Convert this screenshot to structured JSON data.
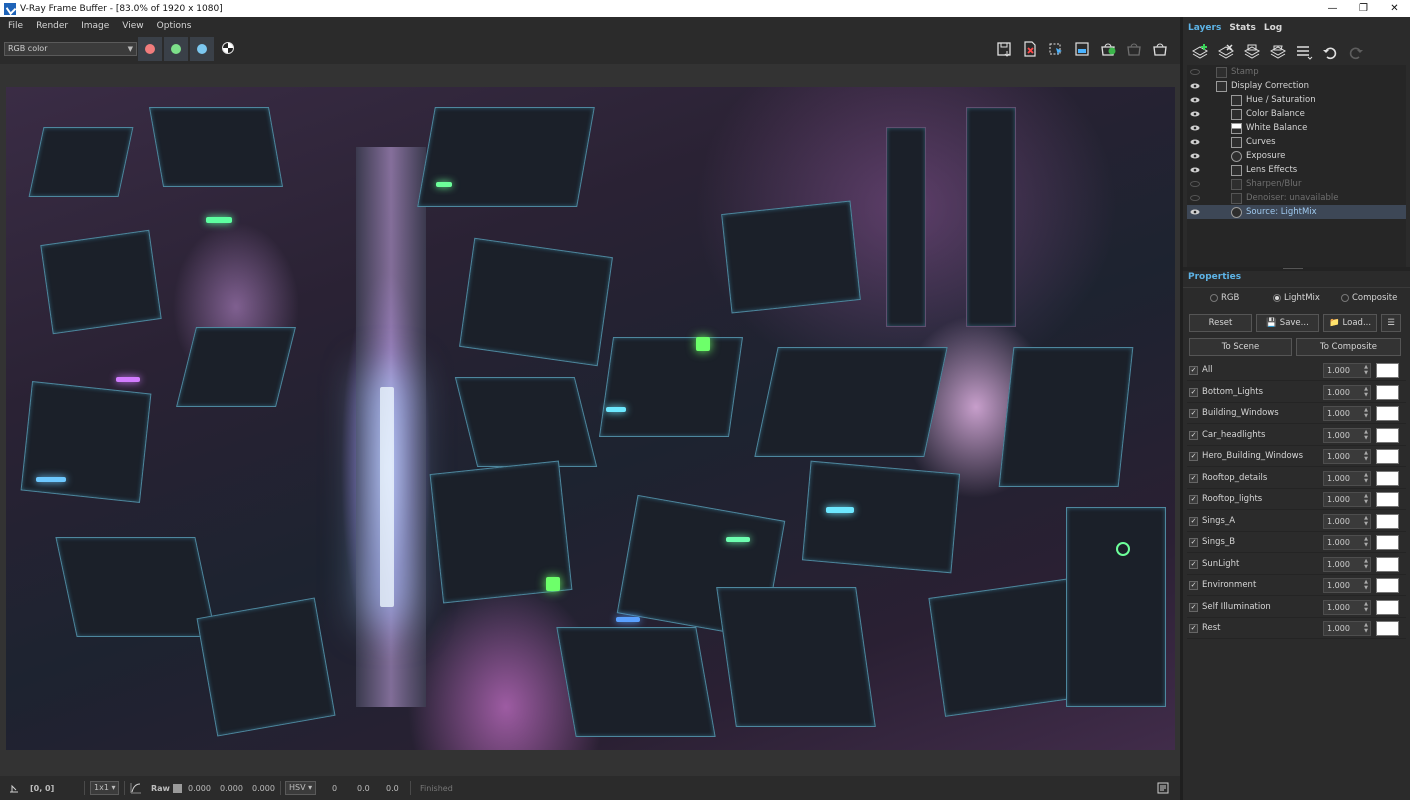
{
  "window": {
    "title": "V-Ray Frame Buffer - [83.0% of 1920 x 1080]",
    "controls": [
      "minimize",
      "maximize",
      "close"
    ]
  },
  "menu": [
    "File",
    "Render",
    "Image",
    "View",
    "Options"
  ],
  "toolbar": {
    "channel_select": "RGB color",
    "channel_buttons": [
      {
        "name": "red-channel",
        "color": "#f07c7c"
      },
      {
        "name": "green-channel",
        "color": "#7de08a"
      },
      {
        "name": "blue-channel",
        "color": "#7cc8f0"
      }
    ],
    "right_icons": [
      "save-image-icon",
      "clear-image-icon",
      "region-render-icon",
      "render-elements-icon",
      "render-icon",
      "render-interactive-icon",
      "stop-render-icon"
    ]
  },
  "status": {
    "coords": "[0, 0]",
    "zoom": "1x1",
    "raw_label": "Raw",
    "raw_values": [
      "0.000",
      "0.000",
      "0.000"
    ],
    "color_mode": "HSV",
    "hsv_values": [
      "0",
      "0.0",
      "0.0"
    ],
    "state": "Finished"
  },
  "panel": {
    "tabs": [
      "Layers",
      "Stats",
      "Log"
    ],
    "active_tab": "Layers",
    "layer_tool_icons": [
      "add-layer-icon",
      "remove-layer-icon",
      "save-layers-icon",
      "load-layers-icon",
      "layers-menu-icon",
      "undo-icon",
      "redo-icon"
    ],
    "layers": [
      {
        "name": "Stamp",
        "visible": false,
        "indent": 1,
        "enabled": false
      },
      {
        "name": "Display Correction",
        "visible": true,
        "indent": 1,
        "enabled": true
      },
      {
        "name": "Hue / Saturation",
        "visible": true,
        "indent": 2,
        "enabled": true
      },
      {
        "name": "Color Balance",
        "visible": true,
        "indent": 2,
        "enabled": true
      },
      {
        "name": "White Balance",
        "visible": true,
        "indent": 2,
        "enabled": true
      },
      {
        "name": "Curves",
        "visible": true,
        "indent": 2,
        "enabled": true
      },
      {
        "name": "Exposure",
        "visible": true,
        "indent": 2,
        "enabled": true
      },
      {
        "name": "Lens Effects",
        "visible": true,
        "indent": 2,
        "enabled": true
      },
      {
        "name": "Sharpen/Blur",
        "visible": false,
        "indent": 2,
        "enabled": false
      },
      {
        "name": "Denoiser: unavailable",
        "visible": false,
        "indent": 2,
        "enabled": false
      },
      {
        "name": "Source: LightMix",
        "visible": true,
        "indent": 2,
        "enabled": true,
        "selected": true
      }
    ],
    "properties_title": "Properties",
    "source_modes": [
      {
        "label": "RGB",
        "selected": false
      },
      {
        "label": "LightMix",
        "selected": true
      },
      {
        "label": "Composite",
        "selected": false
      }
    ],
    "buttons": {
      "reset": "Reset",
      "save": "Save...",
      "load": "Load...",
      "to_scene": "To Scene",
      "to_composite": "To Composite"
    },
    "lightmix": [
      {
        "name": "All",
        "value": "1.000",
        "checked": true
      },
      {
        "name": "Bottom_Lights",
        "value": "1.000",
        "checked": true
      },
      {
        "name": "Building_Windows",
        "value": "1.000",
        "checked": true
      },
      {
        "name": "Car_headlights",
        "value": "1.000",
        "checked": true
      },
      {
        "name": "Hero_Building_Windows",
        "value": "1.000",
        "checked": true
      },
      {
        "name": "Rooftop_details",
        "value": "1.000",
        "checked": true
      },
      {
        "name": "Rooftop_lights",
        "value": "1.000",
        "checked": true
      },
      {
        "name": "Sings_A",
        "value": "1.000",
        "checked": true
      },
      {
        "name": "Sings_B",
        "value": "1.000",
        "checked": true
      },
      {
        "name": "SunLight",
        "value": "1.000",
        "checked": true
      },
      {
        "name": "Environment",
        "value": "1.000",
        "checked": true
      },
      {
        "name": "Self Illumination",
        "value": "1.000",
        "checked": true
      },
      {
        "name": "Rest",
        "value": "1.000",
        "checked": true
      }
    ]
  },
  "colors": {
    "accent": "#5db3e6",
    "panel_bg": "#2b2b2b",
    "viewport_bg": "#333333",
    "selected_row": "#3d4756"
  }
}
